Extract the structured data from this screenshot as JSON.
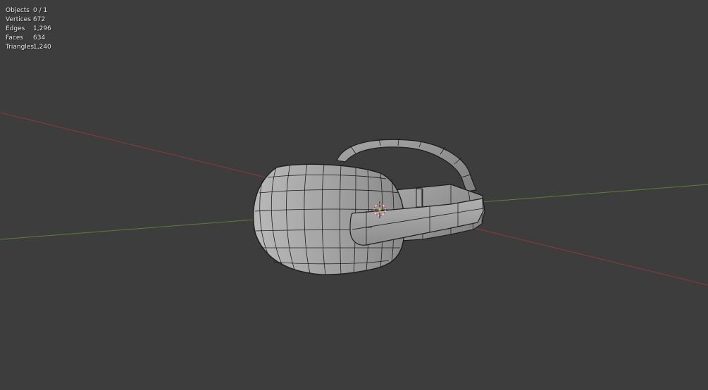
{
  "viewport": {
    "background": "#3d3d3d",
    "x_axis_color": "#8b3a3f",
    "y_axis_color": "#5f7a3c",
    "mesh_fill": "#9a9a9a",
    "mesh_wire": "#1e1e1e"
  },
  "stats": [
    {
      "label": "Objects",
      "value": "0 / 1"
    },
    {
      "label": "Vertices",
      "value": "672"
    },
    {
      "label": "Edges",
      "value": "1,296"
    },
    {
      "label": "Faces",
      "value": "634"
    },
    {
      "label": "Triangles",
      "value": "1,240"
    }
  ],
  "cursor": {
    "icon": "3d-cursor-icon"
  }
}
